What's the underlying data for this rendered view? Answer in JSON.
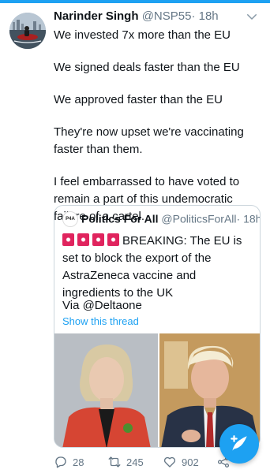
{
  "tweet": {
    "name": "Narinder Singh",
    "handle": "@NSP55",
    "separator": "·",
    "time": "18h",
    "paragraphs": [
      "We invested 7x more than the EU",
      "We signed deals faster than the EU",
      "We approved faster than the EU",
      "They're now upset we're vaccinating faster than them.",
      "I feel embarrassed to have voted to remain a part of this undemocratic failure of a cartel."
    ]
  },
  "quote": {
    "avatar_text": "P4A",
    "name": "Politics For All",
    "handle": "@PoliticsForAll",
    "separator": "·",
    "time": "18h",
    "text": "BREAKING: The EU is set to block the export of the AstraZeneca vaccine and ingredients to the UK",
    "via": "Via @Deltaone",
    "show_thread": "Show this thread"
  },
  "actions": {
    "replies": "28",
    "retweets": "245",
    "likes": "902"
  },
  "colors": {
    "accent": "#1da1f2",
    "muted": "#657786",
    "siren": "#e0245e"
  },
  "icons": {
    "reply": "reply-icon",
    "retweet": "retweet-icon",
    "like": "heart-icon",
    "share": "share-icon",
    "compose": "compose-tweet-icon",
    "caret": "chevron-down-icon",
    "siren": "police-light-emoji"
  }
}
